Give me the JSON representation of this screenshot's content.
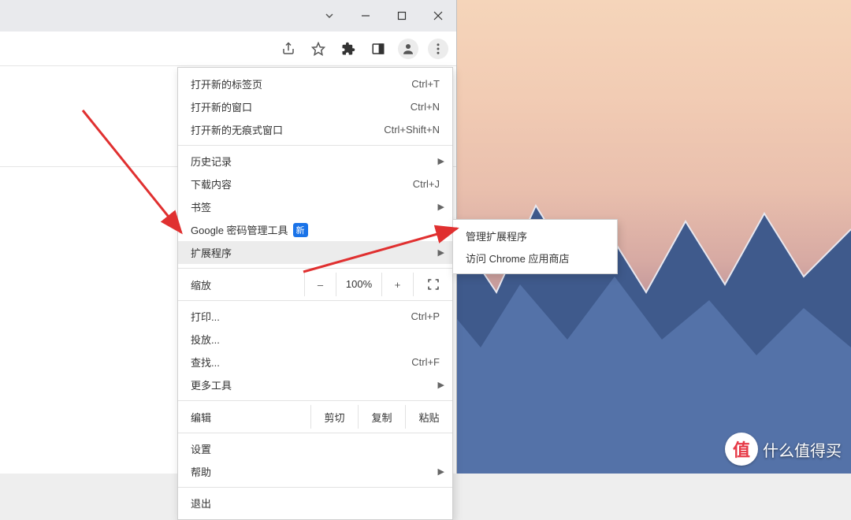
{
  "toolbar_icons": {
    "share": "share-icon",
    "star": "star-icon",
    "extensions": "puzzle-icon",
    "sidepanel": "sidepanel-icon",
    "profile": "profile-icon",
    "more": "more-vert-icon"
  },
  "menu": {
    "new_tab": {
      "label": "打开新的标签页",
      "shortcut": "Ctrl+T"
    },
    "new_window": {
      "label": "打开新的窗口",
      "shortcut": "Ctrl+N"
    },
    "incognito": {
      "label": "打开新的无痕式窗口",
      "shortcut": "Ctrl+Shift+N"
    },
    "history": {
      "label": "历史记录"
    },
    "downloads": {
      "label": "下载内容",
      "shortcut": "Ctrl+J"
    },
    "bookmarks": {
      "label": "书签"
    },
    "passwords": {
      "label": "Google 密码管理工具",
      "badge": "新"
    },
    "extensions": {
      "label": "扩展程序"
    },
    "zoom": {
      "label": "缩放",
      "minus": "–",
      "value": "100%",
      "plus": "+"
    },
    "print": {
      "label": "打印...",
      "shortcut": "Ctrl+P"
    },
    "cast": {
      "label": "投放..."
    },
    "find": {
      "label": "查找...",
      "shortcut": "Ctrl+F"
    },
    "more_tools": {
      "label": "更多工具"
    },
    "edit": {
      "label": "编辑",
      "cut": "剪切",
      "copy": "复制",
      "paste": "粘贴"
    },
    "settings": {
      "label": "设置"
    },
    "help": {
      "label": "帮助"
    },
    "exit": {
      "label": "退出"
    }
  },
  "submenu": {
    "manage": {
      "label": "管理扩展程序"
    },
    "store": {
      "label": "访问 Chrome 应用商店"
    }
  },
  "watermark": {
    "logo": "值",
    "text": "什么值得买"
  }
}
